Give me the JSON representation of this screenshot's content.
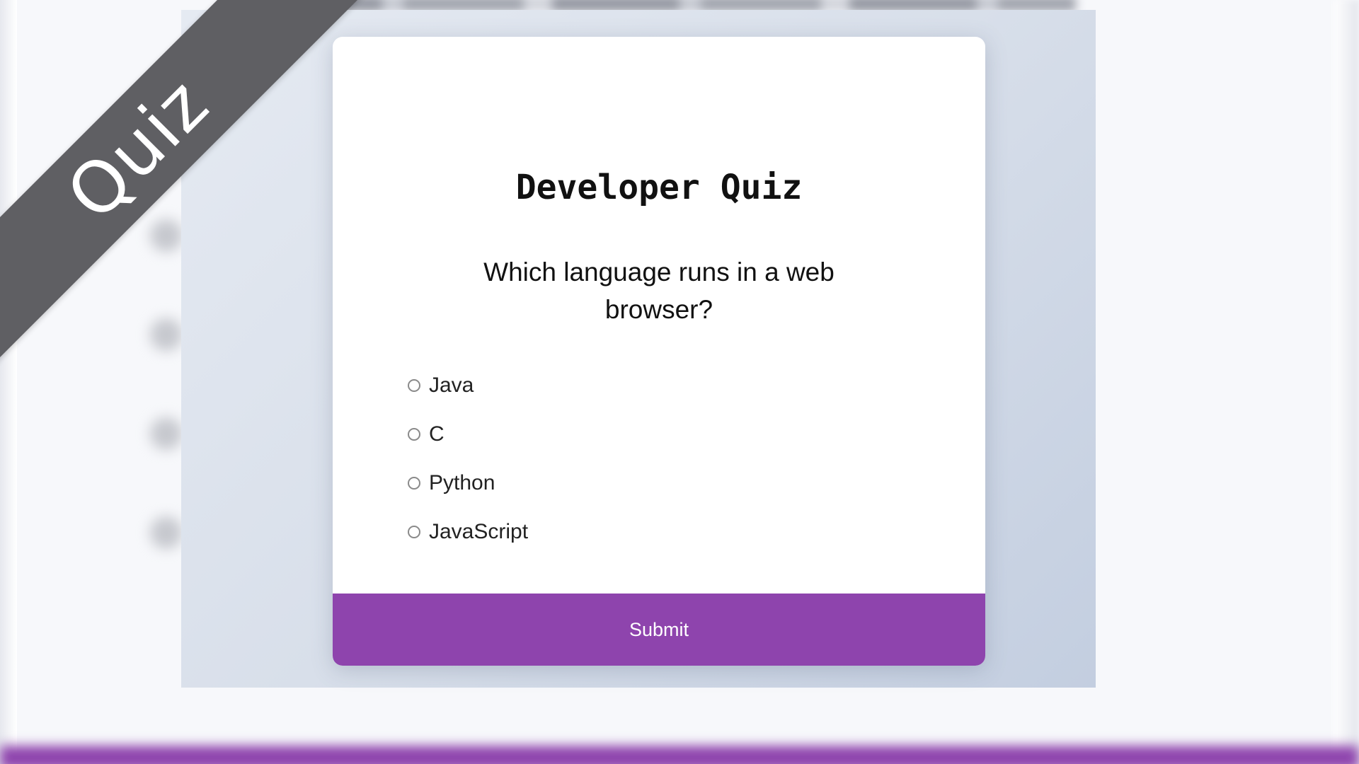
{
  "ribbon": {
    "label": "Quiz"
  },
  "quiz": {
    "title": "Developer Quiz",
    "question": "Which language runs in a web browser?",
    "options": [
      {
        "label": "Java",
        "selected": false
      },
      {
        "label": "C",
        "selected": false
      },
      {
        "label": "Python",
        "selected": false
      },
      {
        "label": "JavaScript",
        "selected": false
      }
    ],
    "submit_label": "Submit"
  },
  "colors": {
    "accent": "#8e44ad",
    "ribbon": "#5f5f63",
    "card_background": "#ffffff"
  },
  "icons": {
    "option_marker": "radio-button-icon"
  }
}
